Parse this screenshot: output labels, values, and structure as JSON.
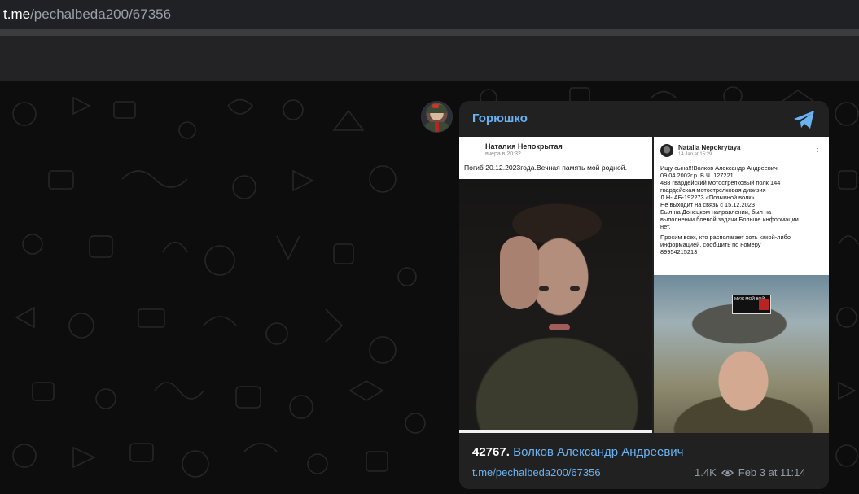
{
  "browser": {
    "url_host": "t.me",
    "url_path": "/pechalbeda200/67356"
  },
  "message": {
    "sender": "Горюшко",
    "media": {
      "left_post": {
        "author": "Наталия Непокрытая",
        "time": "вчера в 20:32",
        "text": "Погиб 20.12.2023года.Вечная память мой родной."
      },
      "right_post": {
        "author": "Natalia Nepokrytaya",
        "time": "14 Jan at 15:29",
        "lines": [
          "Ищу сына!!!Волков Александр Андреевич",
          "09.04.2002г.р. В.Ч. 127221",
          "488 гвардейский мотострелковый полк 144",
          "гвардейская мотострелковая дивизия",
          "Л.Н- АБ-192273 «Позывной волк»",
          "Не выходит на связь с 15.12.2023",
          "Был на Донецком направлении, был на",
          "выполнении боевой задачи.Больше информации",
          "нет.",
          "Просим всех, кто располагает хоть какой-либо",
          "информацией, сообщить по номеру",
          "89954215213"
        ],
        "patch_text": "МУЖ МОЙ ВОЙ"
      }
    },
    "caption_number": "42767.",
    "caption_link": "Волков Александр Андреевич",
    "footer_link": "t.me/pechalbeda200/67356",
    "views": "1.4K",
    "date": "Feb 3 at 11:14"
  },
  "colors": {
    "accent": "#6ab2f2",
    "bubble": "#212121",
    "meta": "#8f9aa3"
  }
}
